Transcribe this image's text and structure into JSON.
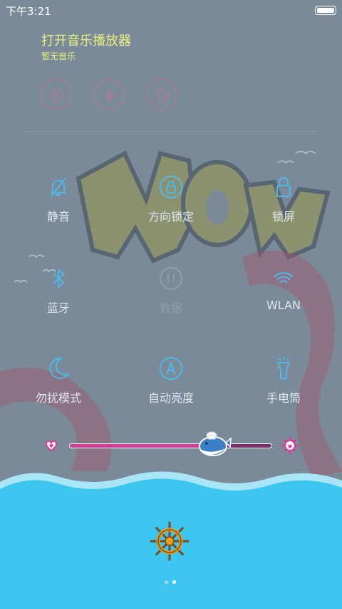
{
  "status_bar": {
    "time": "下午3:21",
    "battery_icon": "battery-icon"
  },
  "music": {
    "title": "打开音乐播放器",
    "subtitle": "暂无音乐",
    "controls": [
      {
        "icon": "previous-icon"
      },
      {
        "icon": "play-icon"
      },
      {
        "icon": "next-icon"
      }
    ]
  },
  "toggles": [
    {
      "label": "静音",
      "icon": "mute-bell-icon",
      "enabled": true
    },
    {
      "label": "方向锁定",
      "icon": "rotation-lock-icon",
      "enabled": true
    },
    {
      "label": "锁屏",
      "icon": "lock-icon",
      "enabled": true
    },
    {
      "label": "蓝牙",
      "icon": "bluetooth-icon",
      "enabled": true
    },
    {
      "label": "数据",
      "icon": "mobile-data-icon",
      "enabled": false
    },
    {
      "label": "WLAN",
      "icon": "wifi-icon",
      "enabled": true
    },
    {
      "label": "勿扰模式",
      "icon": "moon-icon",
      "enabled": true
    },
    {
      "label": "自动亮度",
      "icon": "auto-brightness-icon",
      "enabled": true
    },
    {
      "label": "手电筒",
      "icon": "flashlight-icon",
      "enabled": true
    }
  ],
  "brightness": {
    "level": 0.72,
    "min_icon": "heart-icon",
    "max_icon": "sun-heart-icon",
    "thumb_icon": "whale-icon"
  },
  "dock": {
    "icon": "ship-wheel-icon"
  },
  "pager": {
    "count": 2,
    "active": 1
  },
  "colors": {
    "background": "#7a8a99",
    "music_text": "#e8f07a",
    "label_text": "#dfe7ef",
    "icon_blue": "#4fb8e8",
    "slider_fill": "#d63a9b",
    "sea": "#3cc6ef"
  }
}
